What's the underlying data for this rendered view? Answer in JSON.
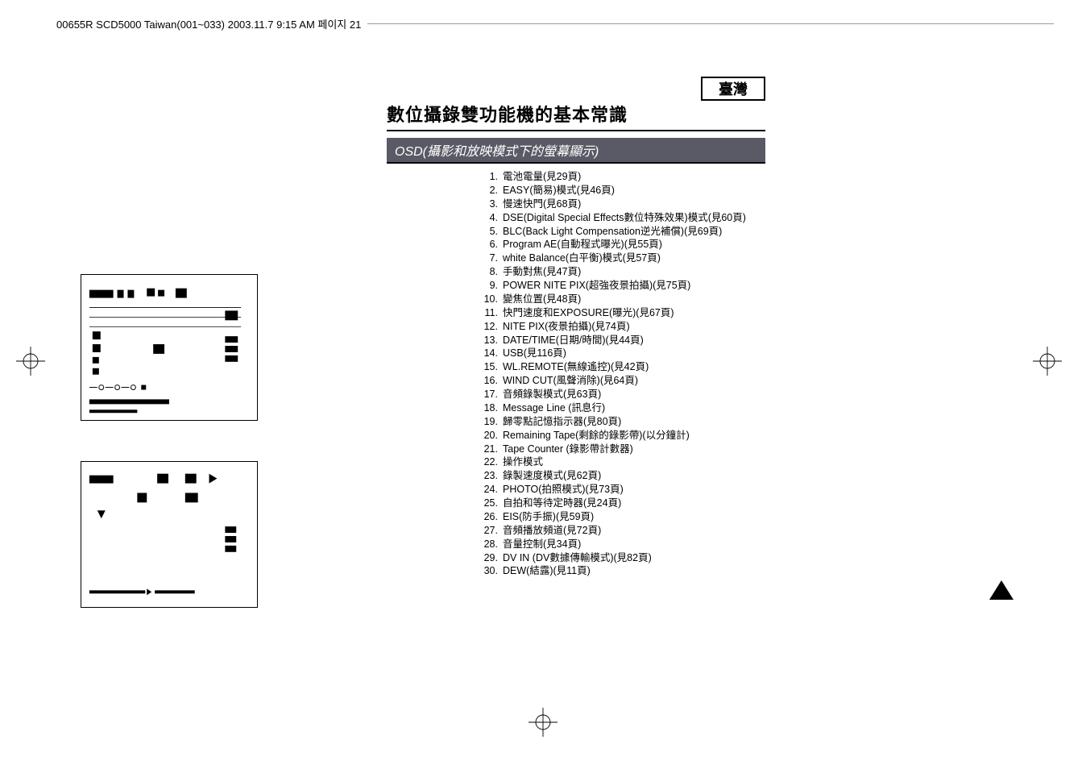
{
  "header": "00655R SCD5000 Taiwan(001~033)  2003.11.7  9:15 AM  페이지 21",
  "region_tag": "臺灣",
  "main_title": "數位攝錄雙功能機的基本常識",
  "subtitle": "OSD(攝影和放映模式下的螢幕顯示)",
  "items": [
    {
      "n": "1.",
      "t": "電池電量(見29頁)"
    },
    {
      "n": "2.",
      "t": "EASY(簡易)模式(見46頁)"
    },
    {
      "n": "3.",
      "t": "慢速快門(見68頁)"
    },
    {
      "n": "4.",
      "t": "DSE(Digital Special Effects數位特殊效果)模式(見60頁)"
    },
    {
      "n": "5.",
      "t": "BLC(Back Light Compensation逆光補償)(見69頁)"
    },
    {
      "n": "6.",
      "t": "Program AE(自動程式曝光)(見55頁)"
    },
    {
      "n": "7.",
      "t": "white Balance(白平衡)模式(見57頁)"
    },
    {
      "n": "8.",
      "t": "手動對焦(見47頁)"
    },
    {
      "n": "9.",
      "t": "POWER NITE PIX(超強夜景拍攝)(見75頁)"
    },
    {
      "n": "10.",
      "t": "變焦位置(見48頁)"
    },
    {
      "n": "11.",
      "t": "快門速度和EXPOSURE(曝光)(見67頁)"
    },
    {
      "n": "12.",
      "t": "NITE PIX(夜景拍攝)(見74頁)"
    },
    {
      "n": "13.",
      "t": "DATE/TIME(日期/時間)(見44頁)"
    },
    {
      "n": "14.",
      "t": "USB(見116頁)"
    },
    {
      "n": "15.",
      "t": "WL.REMOTE(無線遙控)(見42頁)"
    },
    {
      "n": "16.",
      "t": "WIND CUT(風聲消除)(見64頁)"
    },
    {
      "n": "17.",
      "t": "音頻錄製模式(見63頁)"
    },
    {
      "n": "18.",
      "t": "Message Line (訊息行)"
    },
    {
      "n": "19.",
      "t": "歸零點記憶指示器(見80頁)"
    },
    {
      "n": "20.",
      "t": "Remaining Tape(剩餘的錄影帶)(以分鐘計)"
    },
    {
      "n": "21.",
      "t": "Tape Counter (錄影帶計數器)"
    },
    {
      "n": "22.",
      "t": "操作模式"
    },
    {
      "n": "23.",
      "t": "錄製速度模式(見62頁)"
    },
    {
      "n": "24.",
      "t": "PHOTO(拍照模式)(見73頁)"
    },
    {
      "n": "25.",
      "t": "自拍和等待定時器(見24頁)"
    },
    {
      "n": "26.",
      "t": "EIS(防手振)(見59頁)"
    },
    {
      "n": "27.",
      "t": "音頻播放頻道(見72頁)"
    },
    {
      "n": "28.",
      "t": "音量控制(見34頁)"
    },
    {
      "n": "29.",
      "t": "DV IN (DV數據傳輸模式)(見82頁)"
    },
    {
      "n": "30.",
      "t": "DEW(結露)(見11頁)"
    }
  ]
}
